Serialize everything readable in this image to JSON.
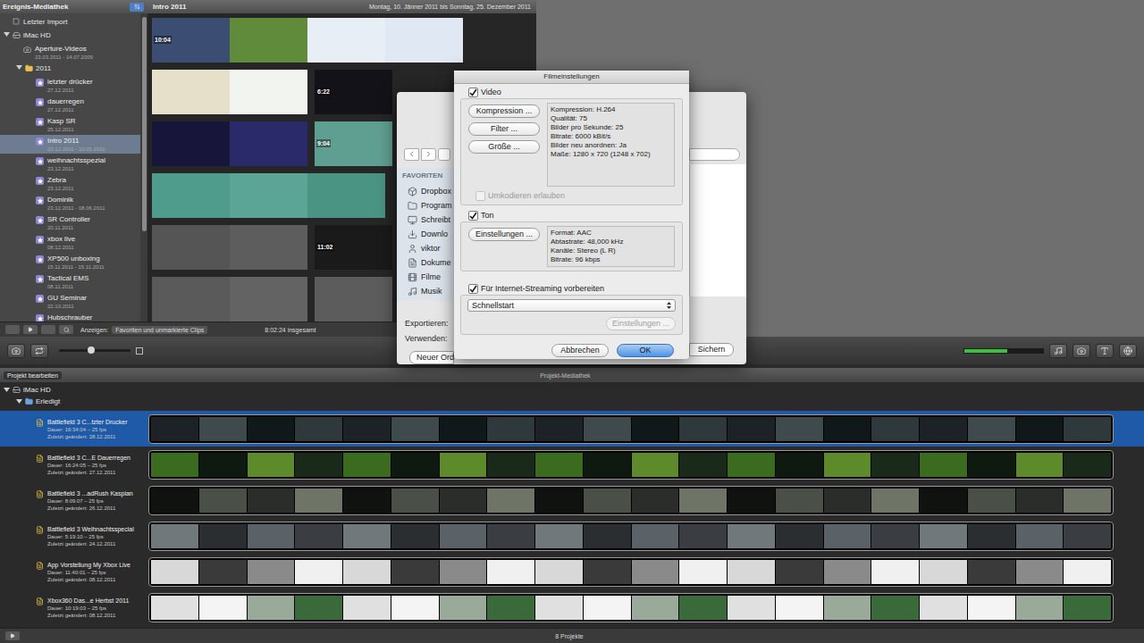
{
  "sidebar": {
    "title": "Ereignis-Mediathek",
    "items": [
      {
        "kind": "import",
        "label": "Letzter Import",
        "date": "",
        "selected": false,
        "expanded": false
      },
      {
        "kind": "drive",
        "label": "iMac HD",
        "date": "",
        "selected": false,
        "expanded": true
      },
      {
        "kind": "aperture",
        "label": "Aperture-Videos",
        "date": "23.03.2011 - 14.07.2009",
        "selected": false,
        "expanded": false
      },
      {
        "kind": "folder",
        "label": "2011",
        "date": "",
        "selected": false,
        "expanded": true
      },
      {
        "kind": "event",
        "label": "letzter drücker",
        "date": "27.12.2011",
        "selected": false,
        "expanded": false
      },
      {
        "kind": "event",
        "label": "dauerregen",
        "date": "27.12.2011",
        "selected": false,
        "expanded": false
      },
      {
        "kind": "event",
        "label": "Kasp SR",
        "date": "25.12.2011",
        "selected": false,
        "expanded": false
      },
      {
        "kind": "event",
        "label": "Intro 2011",
        "date": "20.12.2011 - 10.01.2011",
        "selected": true,
        "expanded": false
      },
      {
        "kind": "event",
        "label": "weihnachtsspezial",
        "date": "23.12.2011",
        "selected": false,
        "expanded": false
      },
      {
        "kind": "event",
        "label": "Zebra",
        "date": "23.12.2011",
        "selected": false,
        "expanded": false
      },
      {
        "kind": "event",
        "label": "Dominik",
        "date": "23.12.2011 - 08.06.2011",
        "selected": false,
        "expanded": false
      },
      {
        "kind": "event",
        "label": "SR Controller",
        "date": "20.11.2011",
        "selected": false,
        "expanded": false
      },
      {
        "kind": "event",
        "label": "xbox live",
        "date": "08.12.2011",
        "selected": false,
        "expanded": false
      },
      {
        "kind": "event",
        "label": "XP500 unboxing",
        "date": "15.11.2011 - 15.11.2011",
        "selected": false,
        "expanded": false
      },
      {
        "kind": "event",
        "label": "Tactical EMS",
        "date": "08.11.2011",
        "selected": false,
        "expanded": false
      },
      {
        "kind": "event",
        "label": "GU Seminar",
        "date": "22.10.2011",
        "selected": false,
        "expanded": false
      },
      {
        "kind": "event",
        "label": "Hubschrauber",
        "date": "",
        "selected": false,
        "expanded": false
      }
    ]
  },
  "browser": {
    "title": "Intro 2011",
    "range": "Montag, 10. Jänner 2011 bis Sonntag, 25. Dezember 2011",
    "rows": [
      {
        "clips": [
          {
            "frames": 4,
            "duration": "10:04"
          }
        ]
      },
      {
        "clips": [
          {
            "frames": 2,
            "duration": ""
          },
          {
            "frames": 1,
            "duration": "6:22"
          }
        ]
      },
      {
        "clips": [
          {
            "frames": 2,
            "duration": ""
          },
          {
            "frames": 1,
            "duration": "9:04"
          }
        ]
      },
      {
        "clips": [
          {
            "frames": 3,
            "duration": ""
          }
        ]
      },
      {
        "clips": [
          {
            "frames": 2,
            "duration": ""
          },
          {
            "frames": 1,
            "duration": "11:02"
          }
        ]
      },
      {
        "clips": [
          {
            "frames": 2,
            "duration": ""
          },
          {
            "frames": 1,
            "duration": ""
          }
        ]
      }
    ],
    "footer": {
      "show_label": "Anzeigen:",
      "filter": "Favoriten und unmarkierte Clips",
      "total": "8:02:24 insgesamt"
    }
  },
  "toolbar": {
    "zoom": {
      "level": 0.45
    },
    "audio_meter": {
      "level": 0.55
    }
  },
  "projects": {
    "edit_button": "Projekt bearbeiten",
    "title": "Projekt-Mediathek",
    "tree": [
      {
        "kind": "drive",
        "label": "iMac HD",
        "expanded": true
      },
      {
        "kind": "folder",
        "label": "Erledigt",
        "expanded": true
      }
    ],
    "items": [
      {
        "title": "Battlefield 3 C...tzter Drucker",
        "duration": "Dauer: 16:34:04 – 25 fps",
        "modified": "Zuletzt geändert: 28.12.2011",
        "selected": true
      },
      {
        "title": "Battlefield 3 C...E Dauerregen",
        "duration": "Dauer: 16:24:05 – 25 fps",
        "modified": "Zuletzt geändert: 27.12.2011",
        "selected": false
      },
      {
        "title": "Battlefield 3 ...adRush Kaspian",
        "duration": "Dauer: 8:09:07 – 25 fps",
        "modified": "Zuletzt geändert: 26.12.2011",
        "selected": false
      },
      {
        "title": "Battlefield 3 Weihnachtsspecial",
        "duration": "Dauer: 5:19:10 – 25 fps",
        "modified": "Zuletzt geändert: 24.12.2011",
        "selected": false
      },
      {
        "title": "App Vorstellung My Xbox Live",
        "duration": "Dauer: 11:40:01 – 25 fps",
        "modified": "Zuletzt geändert: 08.12.2011",
        "selected": false
      },
      {
        "title": "Xbox360 Das...e Herbst 2011",
        "duration": "Dauer: 10:19:03 – 25 fps",
        "modified": "Zuletzt geändert: 08.12.2011",
        "selected": false
      }
    ],
    "footer": "8 Projekte"
  },
  "save_dialog": {
    "favorites_title": "FAVORITEN",
    "favorites": [
      "Dropbox",
      "Program",
      "Schreibt",
      "Downlo",
      "viktor",
      "Dokume",
      "Filme",
      "Musik"
    ],
    "export_label": "Exportieren:",
    "use_label": "Verwenden:",
    "new_folder": "Neuer Ord",
    "save": "Sichern"
  },
  "movie_settings": {
    "title": "Filmeinstellungen",
    "video": {
      "label": "Video",
      "checked": true,
      "buttons": [
        "Kompression ...",
        "Filter ...",
        "Größe ..."
      ],
      "info": [
        "Kompression: H.264",
        "Qualität: 75",
        "Bilder pro Sekunde: 25",
        "Bitrate: 6000 kBit/s",
        "Bilder neu anordnen: Ja",
        "Maße: 1280 x 720 (1248 x 702)"
      ],
      "transcode": {
        "label": "Umkodieren erlauben",
        "checked": false,
        "disabled": true
      }
    },
    "sound": {
      "label": "Ton",
      "checked": true,
      "button": "Einstellungen ...",
      "info": [
        "Format: AAC",
        "Abtastrate: 48,000 kHz",
        "Kanäle: Stereo (L R)",
        "Bitrate: 96 kbps"
      ]
    },
    "streaming": {
      "label": "Für Internet-Streaming vorbereiten",
      "checked": true,
      "option": "Schnellstart",
      "button": {
        "label": "Einstellungen ...",
        "disabled": true
      }
    },
    "buttons": [
      {
        "label": "Abbrechen",
        "default": false
      },
      {
        "label": "OK",
        "default": true
      }
    ]
  }
}
